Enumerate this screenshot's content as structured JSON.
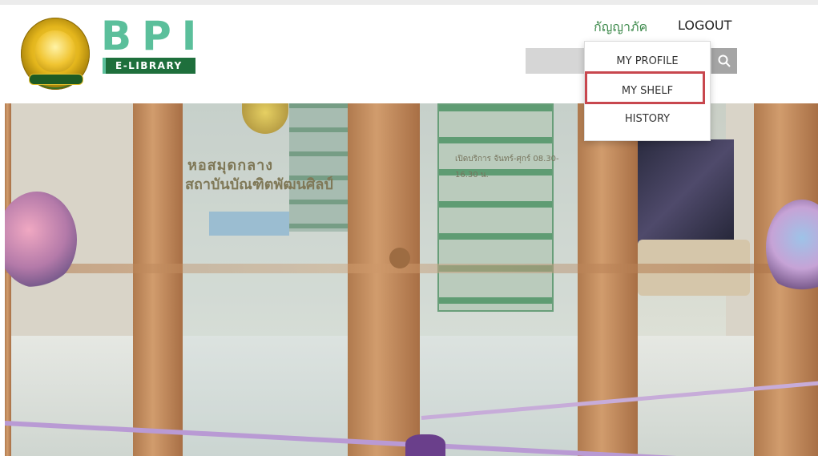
{
  "header": {
    "logo_title": "BPI",
    "logo_subtitle": "E-LIBRARY",
    "user_name": "กัญญาภัค",
    "logout_label": "LOGOUT",
    "search": {
      "value": "",
      "placeholder": ""
    },
    "accent_color": "#5bbf9b"
  },
  "user_menu": {
    "items": [
      {
        "label": "MY PROFILE"
      },
      {
        "label": "MY SHELF",
        "highlighted": true
      },
      {
        "label": "HISTORY"
      }
    ],
    "highlight_color": "#c8474e"
  },
  "hero": {
    "sign_line_1": "หอสมุดกลาง",
    "sign_line_2": "สถาบันบัณฑิตพัฒนศิลป์",
    "sign_line_3": "เปิดบริการ จันทร์-ศุกร์ 08.30-16.30 น."
  }
}
